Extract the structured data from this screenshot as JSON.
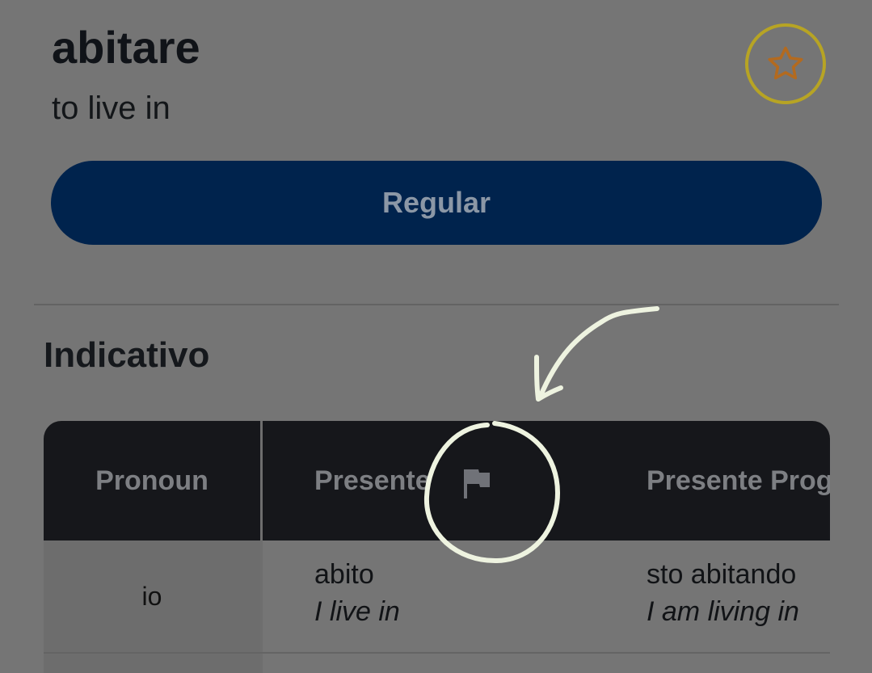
{
  "verb": {
    "title": "abitare",
    "meaning": "to live in"
  },
  "type_button": "Regular",
  "section_title": "Indicativo",
  "table": {
    "headers": {
      "pronoun": "Pronoun",
      "presente": "Presente",
      "progressive": "Presente Progr"
    },
    "rows": [
      {
        "pronoun": "io",
        "presente": "abito",
        "presente_tr": "I live in",
        "progressive": "sto abitando",
        "progressive_tr": "I am living in"
      }
    ]
  },
  "colors": {
    "accent": "#00234d",
    "star": "#b36a1f",
    "star_ring": "#b7a424",
    "annotation": "#eef3e0"
  },
  "icons": {
    "favorite": "star-icon",
    "report": "flag-icon"
  }
}
